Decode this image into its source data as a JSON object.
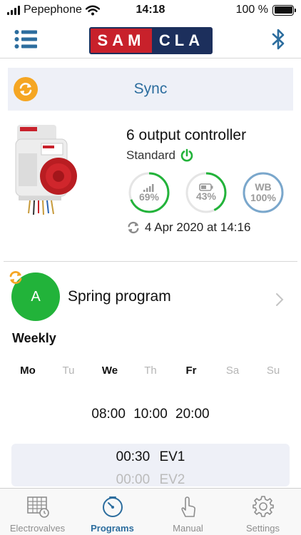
{
  "status_bar": {
    "carrier": "Pepephone",
    "time": "14:18",
    "battery_text": "100 %",
    "battery_level": 1.0
  },
  "nav": {
    "logo_part1": "SAM",
    "logo_part2": "CLA",
    "menu_icon": "list-icon",
    "bluetooth_icon": "bluetooth-icon"
  },
  "sync_bar": {
    "label": "Sync",
    "icon": "sync-icon",
    "icon_color": "#f5a623"
  },
  "controller": {
    "title": "6 output controller",
    "mode": "Standard",
    "mode_icon": "power-icon",
    "mode_icon_color": "#22b33a",
    "gauges": [
      {
        "name": "signal-gauge",
        "icon": "signal-icon",
        "value_text": "69%",
        "level": 0.69,
        "color": "#22b33a"
      },
      {
        "name": "battery-gauge",
        "icon": "battery-icon",
        "value_text": "43%",
        "level": 0.43,
        "color": "#22b33a"
      },
      {
        "name": "wb-gauge",
        "label": "WB",
        "value_text": "100%",
        "level": 1.0,
        "color": "#7aa7cc"
      }
    ],
    "last_sync": "4 Apr 2020 at 14:16"
  },
  "program": {
    "letter": "A",
    "name": "Spring program",
    "avatar_color": "#22b33a",
    "frequency": "Weekly",
    "days": [
      {
        "label": "Mo",
        "active": true
      },
      {
        "label": "Tu",
        "active": false
      },
      {
        "label": "We",
        "active": true
      },
      {
        "label": "Th",
        "active": false
      },
      {
        "label": "Fr",
        "active": true
      },
      {
        "label": "Sa",
        "active": false
      },
      {
        "label": "Su",
        "active": false
      }
    ],
    "start_times": "08:00 10:00 20:00",
    "schedule": [
      {
        "duration": "00:30",
        "valve": "EV1"
      },
      {
        "duration": "00:00",
        "valve": "EV2"
      }
    ]
  },
  "tabs": [
    {
      "label": "Electrovalves",
      "icon": "grid-clock-icon",
      "active": false
    },
    {
      "label": "Programs",
      "icon": "stopwatch-icon",
      "active": true
    },
    {
      "label": "Manual",
      "icon": "hand-pointer-icon",
      "active": false
    },
    {
      "label": "Settings",
      "icon": "gear-icon",
      "active": false
    }
  ],
  "colors": {
    "accent": "#2c6d9e",
    "active_green": "#22b33a",
    "logo_red": "#c8212b",
    "logo_navy": "#1c2f5c"
  }
}
